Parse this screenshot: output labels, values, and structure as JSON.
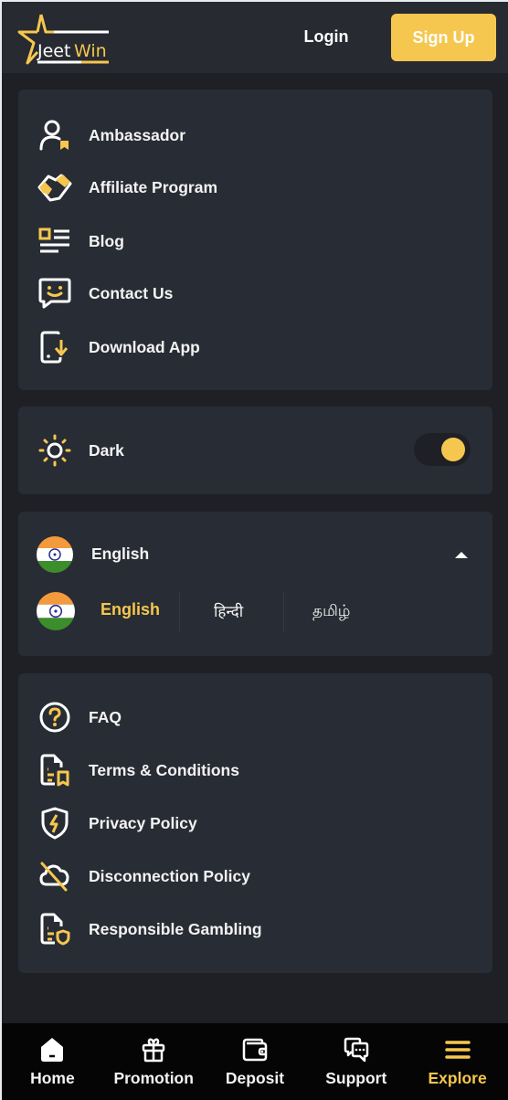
{
  "header": {
    "logo_text_a": "Jeet",
    "logo_text_b": "Win",
    "login_label": "Login",
    "signup_label": "Sign Up"
  },
  "colors": {
    "accent": "#f6c74f",
    "card_bg": "#282c34",
    "page_bg": "#1e2025",
    "header_bg": "#272a31",
    "nav_bg": "#050505"
  },
  "menu_top": [
    {
      "label": "Ambassador",
      "icon": "ambassador-icon"
    },
    {
      "label": "Affiliate Program",
      "icon": "handshake-icon"
    },
    {
      "label": "Blog",
      "icon": "blog-icon"
    },
    {
      "label": "Contact Us",
      "icon": "chat-smile-icon"
    },
    {
      "label": "Download App",
      "icon": "download-app-icon"
    }
  ],
  "theme": {
    "label": "Dark",
    "icon": "sun-icon",
    "enabled": true
  },
  "language": {
    "selected": "English",
    "options": [
      {
        "label": "English",
        "active": true
      },
      {
        "label": "हिन्दी",
        "active": false
      },
      {
        "label": "தமிழ்",
        "active": false
      }
    ]
  },
  "menu_bottom": [
    {
      "label": "FAQ",
      "icon": "question-icon"
    },
    {
      "label": "Terms & Conditions",
      "icon": "document-icon"
    },
    {
      "label": "Privacy Policy",
      "icon": "shield-icon"
    },
    {
      "label": "Disconnection Policy",
      "icon": "cloud-off-icon"
    },
    {
      "label": "Responsible Gambling",
      "icon": "document-shield-icon"
    }
  ],
  "bottom_nav": [
    {
      "label": "Home",
      "icon": "home-icon",
      "active": false
    },
    {
      "label": "Promotion",
      "icon": "gift-icon",
      "active": false
    },
    {
      "label": "Deposit",
      "icon": "wallet-icon",
      "active": false
    },
    {
      "label": "Support",
      "icon": "support-chat-icon",
      "active": false
    },
    {
      "label": "Explore",
      "icon": "menu-icon",
      "active": true
    }
  ]
}
